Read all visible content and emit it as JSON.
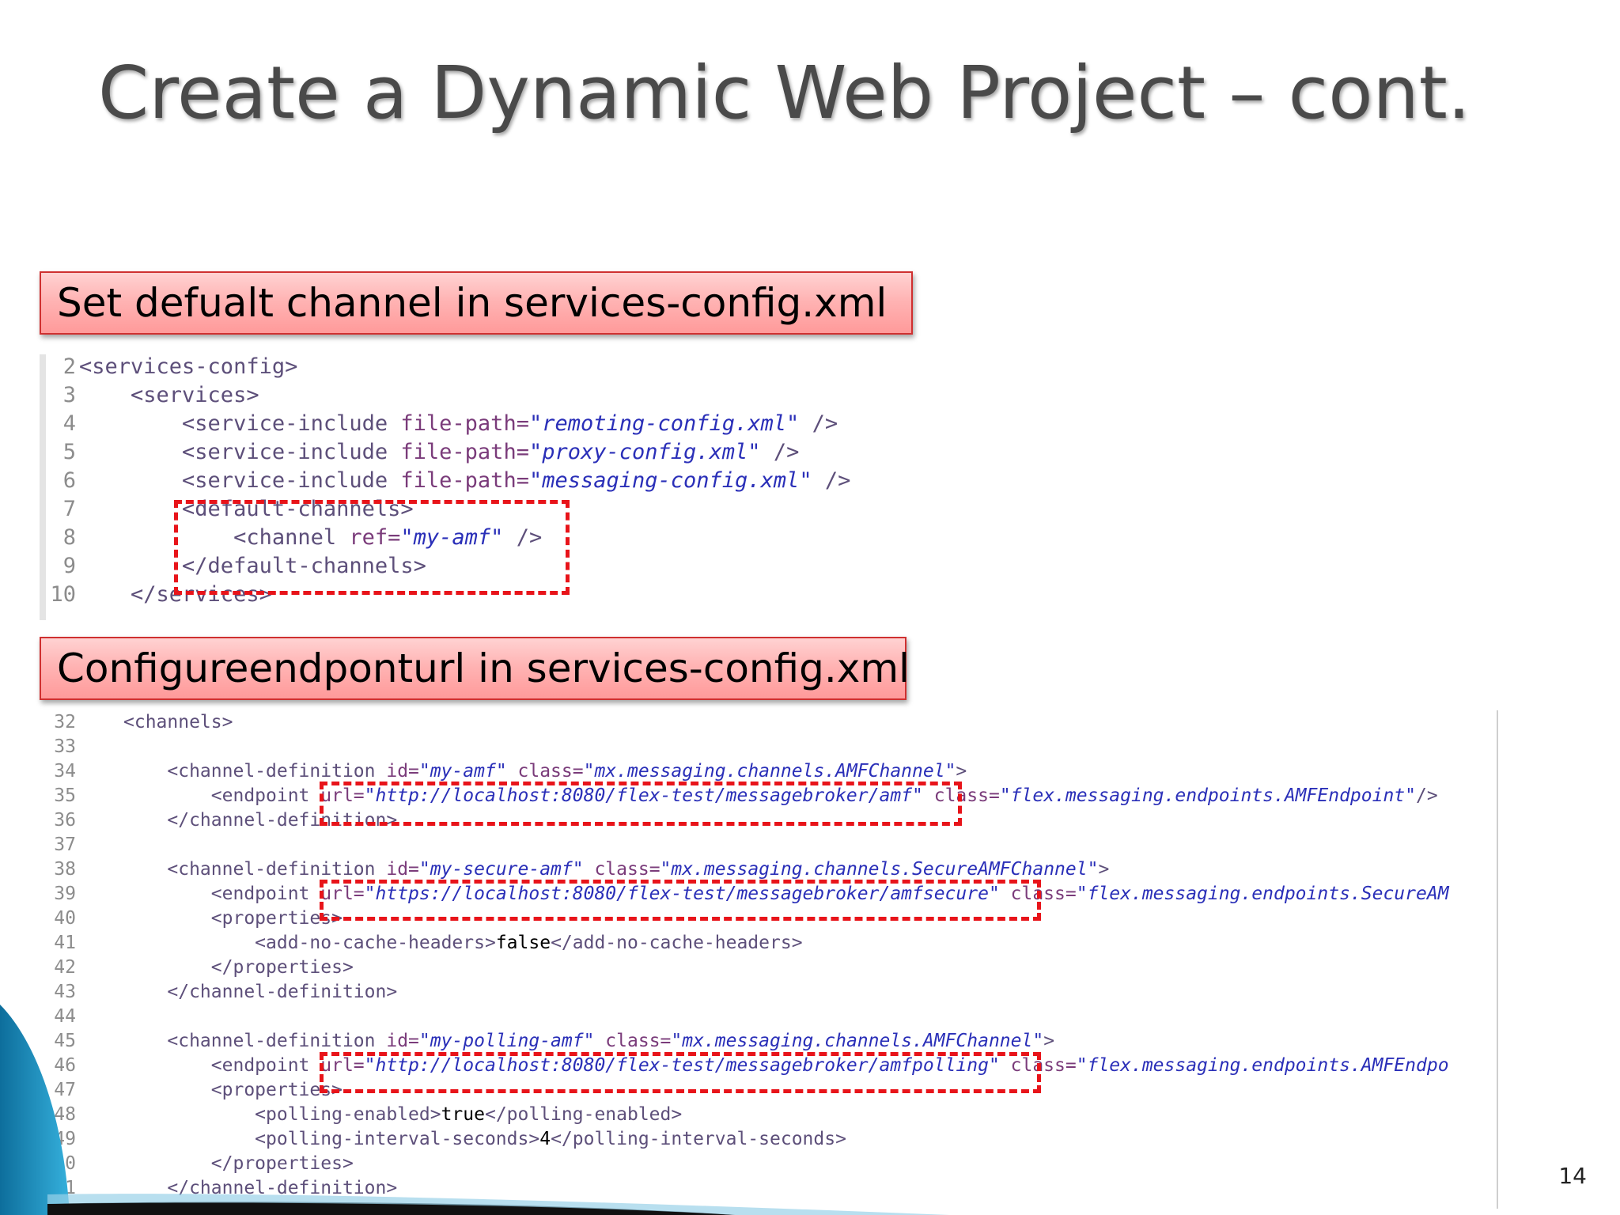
{
  "title": "Create a Dynamic Web Project – cont.",
  "callout1": "Set defualt channel in services-config.xml",
  "callout2": "Configureendponturl in services-config.xml",
  "page_number": "14",
  "colors": {
    "accent_red": "#e8141a",
    "callout_bg": "#ffb4b4",
    "swoosh_blue": "#1a8fc0"
  },
  "code1": {
    "lines": [
      {
        "n": "2",
        "tag": "<services-config>"
      },
      {
        "n": "3",
        "tag": "    <services>"
      },
      {
        "n": "4",
        "tag": "        <service-include",
        "attr": " file-path=",
        "val": "\"remoting-config.xml\"",
        "end": " />"
      },
      {
        "n": "5",
        "tag": "        <service-include",
        "attr": " file-path=",
        "val": "\"proxy-config.xml\"",
        "end": " />"
      },
      {
        "n": "6",
        "tag": "        <service-include",
        "attr": " file-path=",
        "val": "\"messaging-config.xml\"",
        "end": " />"
      },
      {
        "n": "7",
        "tag": "        <default-channels>"
      },
      {
        "n": "8",
        "tag": "            <channel",
        "attr": " ref=",
        "val": "\"my-amf\"",
        "end": " />"
      },
      {
        "n": "9",
        "tag": "        </default-channels>"
      },
      {
        "n": "10",
        "tag": "    </services>"
      }
    ]
  },
  "code2": {
    "lines": [
      {
        "n": "32",
        "tag": "<channels>"
      },
      {
        "n": "33",
        "tag": ""
      },
      {
        "n": "34",
        "tag": "    <channel-definition",
        "attr": " id=",
        "val": "\"my-amf\"",
        "attr2": " class=",
        "val2": "\"mx.messaging.channels.AMFChannel\"",
        "end": ">"
      },
      {
        "n": "35",
        "tag": "        <endpoint",
        "attr": " url=",
        "val": "\"http://localhost:8080/flex-test/messagebroker/amf\"",
        "attr2": " class=",
        "val2": "\"flex.messaging.endpoints.AMFEndpoint\"",
        "end": "/>"
      },
      {
        "n": "36",
        "tag": "    </channel-definition>"
      },
      {
        "n": "37",
        "tag": ""
      },
      {
        "n": "38",
        "tag": "    <channel-definition",
        "attr": " id=",
        "val": "\"my-secure-amf\"",
        "attr2": " class=",
        "val2": "\"mx.messaging.channels.SecureAMFChannel\"",
        "end": ">"
      },
      {
        "n": "39",
        "tag": "        <endpoint",
        "attr": " url=",
        "val": "\"https://localhost:8080/flex-test/messagebroker/amfsecure\"",
        "attr2": " class=",
        "val2": "\"flex.messaging.endpoints.SecureAM",
        "end": ""
      },
      {
        "n": "40",
        "tag": "        <properties>"
      },
      {
        "n": "41",
        "tag": "            <add-no-cache-headers>",
        "text": "false",
        "end": "</add-no-cache-headers>"
      },
      {
        "n": "42",
        "tag": "        </properties>"
      },
      {
        "n": "43",
        "tag": "    </channel-definition>"
      },
      {
        "n": "44",
        "tag": ""
      },
      {
        "n": "45",
        "tag": "    <channel-definition",
        "attr": " id=",
        "val": "\"my-polling-amf\"",
        "attr2": " class=",
        "val2": "\"mx.messaging.channels.AMFChannel\"",
        "end": ">"
      },
      {
        "n": "46",
        "tag": "        <endpoint",
        "attr": " url=",
        "val": "\"http://localhost:8080/flex-test/messagebroker/amfpolling\"",
        "attr2": " class=",
        "val2": "\"flex.messaging.endpoints.AMFEndpo",
        "end": ""
      },
      {
        "n": "47",
        "tag": "        <properties>"
      },
      {
        "n": "48",
        "tag": "            <polling-enabled>",
        "text": "true",
        "end": "</polling-enabled>"
      },
      {
        "n": "49",
        "tag": "            <polling-interval-seconds>",
        "text": "4",
        "end": "</polling-interval-seconds>"
      },
      {
        "n": "50",
        "tag": "        </properties>"
      },
      {
        "n": "51",
        "tag": "    </channel-definition>"
      }
    ]
  }
}
